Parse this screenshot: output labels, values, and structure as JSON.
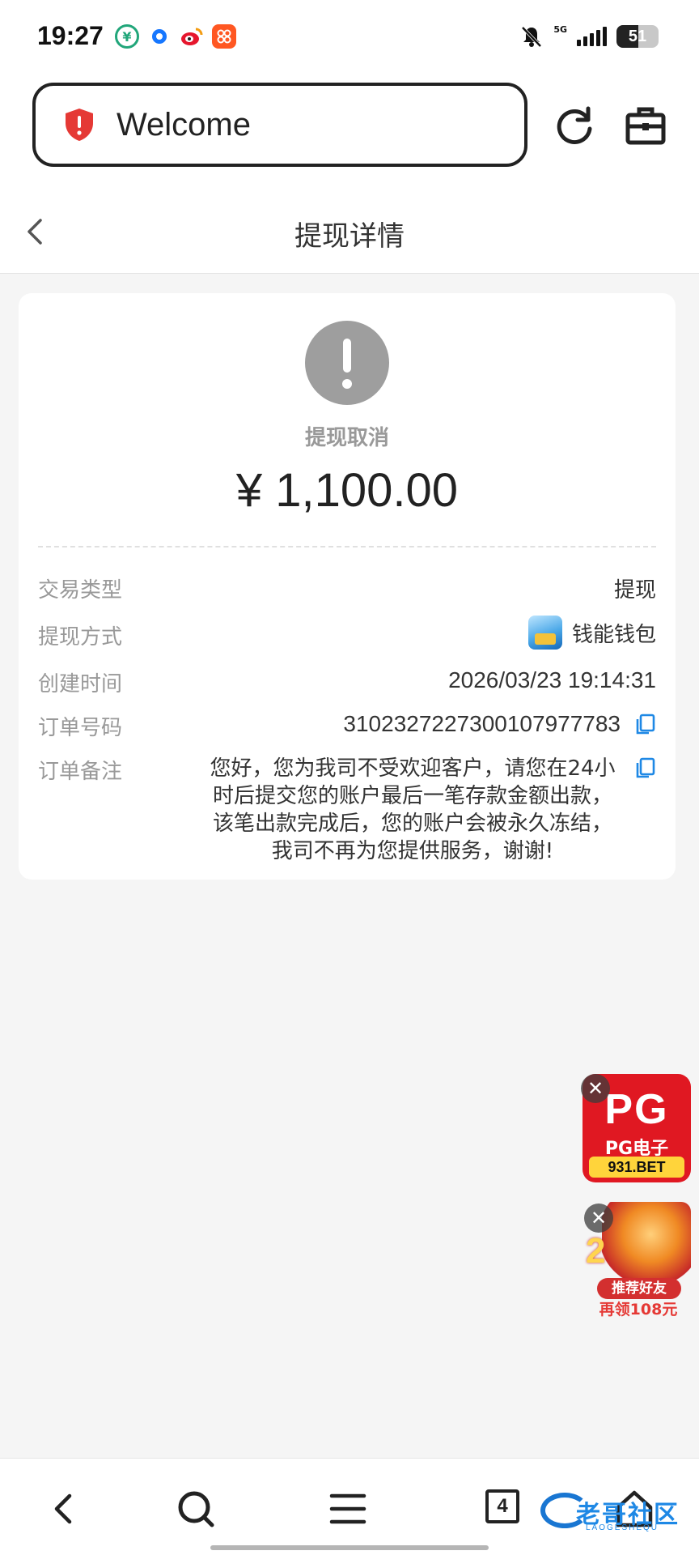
{
  "status_bar": {
    "time": "19:27",
    "network": "5G",
    "battery": "51",
    "battery_level": 0.51,
    "notification_icons": [
      "app-icon-green",
      "app-icon-blue-circle",
      "weibo-icon",
      "orange-app-icon"
    ]
  },
  "browser": {
    "url_text": "Welcome",
    "security_icon": "shield-alert-icon"
  },
  "header": {
    "title": "提现详情"
  },
  "detail": {
    "status_text": "提现取消",
    "amount": "¥ 1,100.00",
    "rows": {
      "type": {
        "label": "交易类型",
        "value": "提现"
      },
      "method": {
        "label": "提现方式",
        "value": "钱能钱包"
      },
      "created": {
        "label": "创建时间",
        "value": "2026/03/23 19:14:31"
      },
      "order_no": {
        "label": "订单号码",
        "value": "3102327227300107977783"
      },
      "remark": {
        "label": "订单备注",
        "value": "您好，您为我司不受欢迎客户，请您在24小时后提交您的账户最后一笔存款金额出款，该笔出款完成后，您的账户会被永久冻结，我司不再为您提供服务，谢谢!"
      }
    }
  },
  "ads": {
    "pg": {
      "logo": "PG",
      "subtitle": "PG电子",
      "domain": "931.BET"
    },
    "referral": {
      "number": "2",
      "tag": "推荐好友",
      "bonus": "再领108元"
    },
    "close_symbol": "✕"
  },
  "bottom_nav": {
    "tab_count": "4"
  },
  "watermark": {
    "text": "老哥社区",
    "sub": "LAOGESHEQU"
  },
  "colors": {
    "accent_blue": "#1e88e5",
    "status_gray": "#9e9e9e",
    "shield_red": "#e53935",
    "ad_red": "#e01822"
  }
}
